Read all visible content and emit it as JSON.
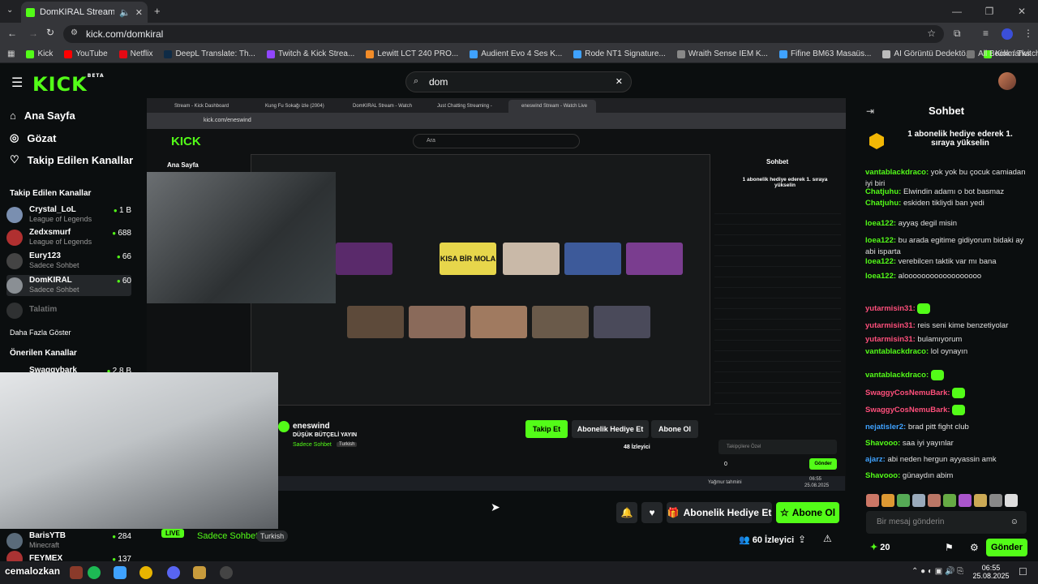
{
  "browser": {
    "tab_title": "DomKIRAL Stream - Watch",
    "url": "kick.com/domkiral",
    "bookmarks": [
      "Kick",
      "YouTube",
      "Netflix",
      "DeepL Translate: Th...",
      "Twitch & Kick Strea...",
      "Lewitt LCT 240 PRO...",
      "Audient Evo 4 Ses K...",
      "Rode NT1 Signature...",
      "Wraith Sense IEM K...",
      "Fifine BM63 Masaüs...",
      "AI Görüntü Dedektö...",
      "Kick / Twitch VOD d..."
    ],
    "all_bookmarks": "All Bookmarks"
  },
  "site": {
    "logo": "KICK",
    "logo_badge": "BETA",
    "search_value": "dom"
  },
  "sidebar": {
    "nav": [
      "Ana Sayfa",
      "Gözat",
      "Takip Edilen Kanallar"
    ],
    "followed_title": "Takip Edilen Kanallar",
    "followed": [
      {
        "name": "Crystal_LoL",
        "game": "League of Legends",
        "viewers": "1 B"
      },
      {
        "name": "Zedxsmurf",
        "game": "League of Legends",
        "viewers": "688"
      },
      {
        "name": "Eury123",
        "game": "Sadece Sohbet",
        "viewers": "66"
      },
      {
        "name": "DomKIRAL",
        "game": "Sadece Sohbet",
        "viewers": "60"
      },
      {
        "name": "Talatim",
        "game": "",
        "viewers": ""
      }
    ],
    "show_more": "Daha Fazla Göster",
    "recommended_title": "Önerilen Kanallar",
    "recommended": [
      {
        "name": "Swaggybark",
        "viewers": "2,8 B"
      },
      {
        "name": "BarisYTB",
        "game": "Minecraft",
        "viewers": "284"
      },
      {
        "name": "FEYMEX",
        "viewers": "137"
      }
    ]
  },
  "inner": {
    "tabs": [
      "Stream - Kick Dashboard",
      "Kung Fu Sokağı izle (2004)",
      "DomKIRAL Stream - Watch Live",
      "Just Chatting Streaming - Live",
      "eneswind Stream - Watch Live"
    ],
    "url": "kick.com/eneswind",
    "search_placeholder": "Ara",
    "home": "Ana Sayfa",
    "chat_title": "Sohbet",
    "pin_text": "1 abonelik hediye ederek 1. sıraya yükselin",
    "streamer": "eneswind",
    "stream_title": "DÜŞÜK BÜTÇELİ YAYIN",
    "category": "Sadece Sohbet",
    "lang": "Turkish",
    "follow": "Takip Et",
    "gift": "Abonelik Hediye Et",
    "sub": "Abone Ol",
    "viewers": "48 İzleyici",
    "chat_input": "Takipçilere Özel",
    "send": "Gönder",
    "points": "0",
    "weather": "Yağmur tahmini",
    "time": "06:55",
    "date": "25.08.2025",
    "thumb_text": "KISA BİR MOLA"
  },
  "stream": {
    "live": "LIVE",
    "category": "Sadece Sohbet",
    "lang": "Turkish",
    "gift": "Abonelik Hediye Et",
    "sub": "Abone Ol",
    "viewers": "60 İzleyici",
    "overlay_name": "cemalozkan"
  },
  "chat": {
    "title": "Sohbet",
    "pin": "1 abonelik hediye ederek 1. sıraya yükselin",
    "messages": [
      {
        "user": "vantablackdraco:",
        "color": "#53fc18",
        "text": "yok yok bu çocuk camiadan iyi biri"
      },
      {
        "user": "Chatjuhu:",
        "color": "#53fc18",
        "text": "Elwindin adamı o bot basmaz"
      },
      {
        "user": "Chatjuhu:",
        "color": "#53fc18",
        "text": "eskiden tikliydi ban yedi"
      },
      {
        "user": "loea122:",
        "color": "#53fc18",
        "text": "ayyaş degil misin"
      },
      {
        "user": "loea122:",
        "color": "#53fc18",
        "text": "bu arada egitime gidiyorum bidaki ay abi isparta"
      },
      {
        "user": "loea122:",
        "color": "#53fc18",
        "text": "verebilcen taktik var mı bana"
      },
      {
        "user": "loea122:",
        "color": "#53fc18",
        "text": "aloooooooooooooooooo"
      },
      {
        "user": "yutarmisin31:",
        "color": "#ff4f7b",
        "text": ""
      },
      {
        "user": "yutarmisin31:",
        "color": "#ff4f7b",
        "text": "reis seni kime benzetiyolar"
      },
      {
        "user": "yutarmisin31:",
        "color": "#ff4f7b",
        "text": "bulamıyorum"
      },
      {
        "user": "vantablackdraco:",
        "color": "#53fc18",
        "text": "lol oynayın"
      },
      {
        "user": "vantablackdraco:",
        "color": "#53fc18",
        "text": ""
      },
      {
        "user": "SwaggyCosNemuBark:",
        "color": "#ff4f7b",
        "text": ""
      },
      {
        "user": "SwaggyCosNemuBark:",
        "color": "#ff4f7b",
        "text": ""
      },
      {
        "user": "nejatisler2:",
        "color": "#3fa2ff",
        "text": "brad pitt fight club"
      },
      {
        "user": "Shavooo:",
        "color": "#53fc18",
        "text": "saa iyi yayınlar"
      },
      {
        "user": "ajarz:",
        "color": "#3fa2ff",
        "text": "abi neden hergun ayyassin amk"
      },
      {
        "user": "Shavooo:",
        "color": "#53fc18",
        "text": "günaydın abim"
      }
    ],
    "input_placeholder": "Bir mesaj gönderin",
    "points": "20",
    "send": "Gönder"
  },
  "taskbar": {
    "time": "06:55",
    "date": "25.08.2025"
  },
  "colors": {
    "accent": "#53fc18",
    "bg": "#0b0e0f"
  }
}
